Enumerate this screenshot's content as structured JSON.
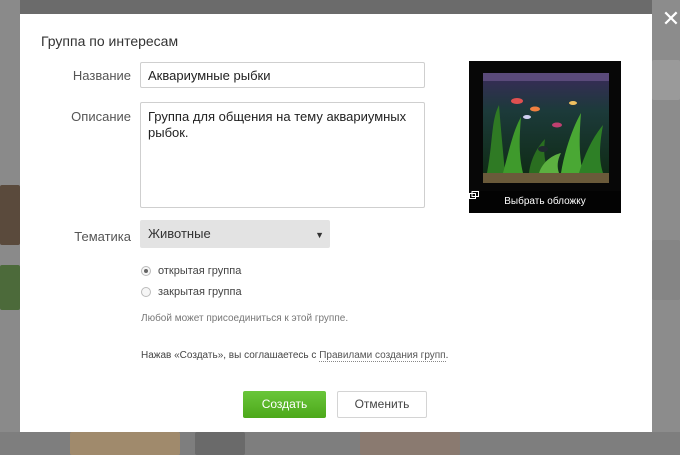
{
  "dialog": {
    "title": "Группа по интересам",
    "close_label": "✕"
  },
  "form": {
    "name": {
      "label": "Название",
      "value": "Аквариумные рыбки"
    },
    "description": {
      "label": "Описание",
      "value": "Группа для общения на тему аквариумных рыбок."
    },
    "topic": {
      "label": "Тематика",
      "selected": "Животные"
    },
    "privacy": {
      "options": [
        {
          "label": "открытая группа",
          "checked": true
        },
        {
          "label": "закрытая группа",
          "checked": false
        }
      ],
      "hint": "Любой может присоединиться к этой группе."
    },
    "agreement": {
      "text": "Нажав «Создать», вы соглашаетесь с ",
      "link": "Правилами создания групп",
      "suffix": "."
    }
  },
  "cover": {
    "caption": "Выбрать обложку",
    "icon": "image-icon"
  },
  "buttons": {
    "create": "Создать",
    "cancel": "Отменить"
  },
  "colors": {
    "primary_button": "#4fae1b",
    "overlay": "#6b6b6b"
  }
}
